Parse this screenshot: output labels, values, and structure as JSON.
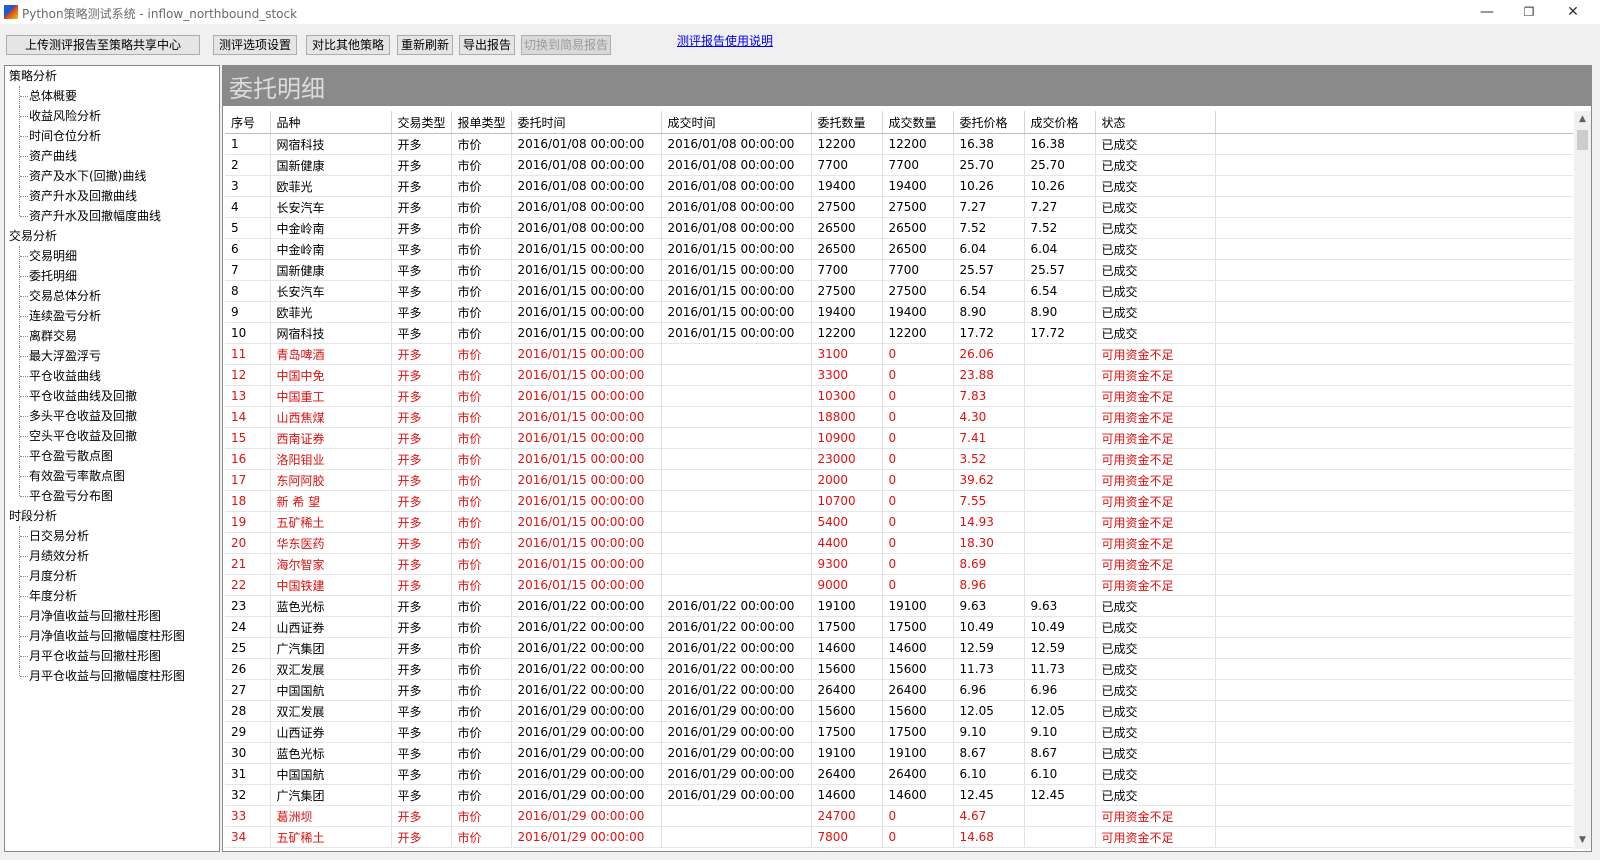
{
  "window": {
    "title": "Python策略测试系统 - inflow_northbound_stock",
    "minimize": "—",
    "maximize": "❐",
    "close": "✕"
  },
  "toolbar": {
    "upload_label": "上传测评报告至策略共享中心",
    "settings_label": "测评选项设置",
    "compare_label": "对比其他策略",
    "refresh_label": "重新刷新",
    "export_label": "导出报告",
    "simple_label": "切换到简易报告",
    "help_link": "测评报告使用说明"
  },
  "sidebar": {
    "sections": [
      {
        "label": "策略分析",
        "items": [
          "总体概要",
          "收益风险分析",
          "时间仓位分析",
          "资产曲线",
          "资产及水下(回撤)曲线",
          "资产升水及回撤曲线",
          "资产升水及回撤幅度曲线"
        ]
      },
      {
        "label": "交易分析",
        "items": [
          "交易明细",
          "委托明细",
          "交易总体分析",
          "连续盈亏分析",
          "离群交易",
          "最大浮盈浮亏",
          "平仓收益曲线",
          "平仓收益曲线及回撤",
          "多头平仓收益及回撤",
          "空头平仓收益及回撤",
          "平仓盈亏散点图",
          "有效盈亏率散点图",
          "平仓盈亏分布图"
        ]
      },
      {
        "label": "时段分析",
        "items": [
          "日交易分析",
          "月绩效分析",
          "月度分析",
          "年度分析",
          "月净值收益与回撤柱形图",
          "月净值收益与回撤幅度柱形图",
          "月平仓收益与回撤柱形图",
          "月平仓收益与回撤幅度柱形图"
        ]
      }
    ]
  },
  "main": {
    "section_title": "委托明细",
    "columns": [
      "序号",
      "品种",
      "交易类型",
      "报单类型",
      "委托时间",
      "成交时间",
      "委托数量",
      "成交数量",
      "委托价格",
      "成交价格",
      "状态"
    ],
    "rows": [
      [
        "1",
        "网宿科技",
        "开多",
        "市价",
        "2016/01/08 00:00:00",
        "2016/01/08 00:00:00",
        "12200",
        "12200",
        "16.38",
        "16.38",
        "已成交"
      ],
      [
        "2",
        "国新健康",
        "开多",
        "市价",
        "2016/01/08 00:00:00",
        "2016/01/08 00:00:00",
        "7700",
        "7700",
        "25.70",
        "25.70",
        "已成交"
      ],
      [
        "3",
        "欧菲光",
        "开多",
        "市价",
        "2016/01/08 00:00:00",
        "2016/01/08 00:00:00",
        "19400",
        "19400",
        "10.26",
        "10.26",
        "已成交"
      ],
      [
        "4",
        "长安汽车",
        "开多",
        "市价",
        "2016/01/08 00:00:00",
        "2016/01/08 00:00:00",
        "27500",
        "27500",
        "7.27",
        "7.27",
        "已成交"
      ],
      [
        "5",
        "中金岭南",
        "开多",
        "市价",
        "2016/01/08 00:00:00",
        "2016/01/08 00:00:00",
        "26500",
        "26500",
        "7.52",
        "7.52",
        "已成交"
      ],
      [
        "6",
        "中金岭南",
        "平多",
        "市价",
        "2016/01/15 00:00:00",
        "2016/01/15 00:00:00",
        "26500",
        "26500",
        "6.04",
        "6.04",
        "已成交"
      ],
      [
        "7",
        "国新健康",
        "平多",
        "市价",
        "2016/01/15 00:00:00",
        "2016/01/15 00:00:00",
        "7700",
        "7700",
        "25.57",
        "25.57",
        "已成交"
      ],
      [
        "8",
        "长安汽车",
        "平多",
        "市价",
        "2016/01/15 00:00:00",
        "2016/01/15 00:00:00",
        "27500",
        "27500",
        "6.54",
        "6.54",
        "已成交"
      ],
      [
        "9",
        "欧菲光",
        "平多",
        "市价",
        "2016/01/15 00:00:00",
        "2016/01/15 00:00:00",
        "19400",
        "19400",
        "8.90",
        "8.90",
        "已成交"
      ],
      [
        "10",
        "网宿科技",
        "平多",
        "市价",
        "2016/01/15 00:00:00",
        "2016/01/15 00:00:00",
        "12200",
        "12200",
        "17.72",
        "17.72",
        "已成交"
      ],
      [
        "11",
        "青岛啤酒",
        "开多",
        "市价",
        "2016/01/15 00:00:00",
        "",
        "3100",
        "0",
        "26.06",
        "",
        "可用资金不足"
      ],
      [
        "12",
        "中国中免",
        "开多",
        "市价",
        "2016/01/15 00:00:00",
        "",
        "3300",
        "0",
        "23.88",
        "",
        "可用资金不足"
      ],
      [
        "13",
        "中国重工",
        "开多",
        "市价",
        "2016/01/15 00:00:00",
        "",
        "10300",
        "0",
        "7.83",
        "",
        "可用资金不足"
      ],
      [
        "14",
        "山西焦煤",
        "开多",
        "市价",
        "2016/01/15 00:00:00",
        "",
        "18800",
        "0",
        "4.30",
        "",
        "可用资金不足"
      ],
      [
        "15",
        "西南证券",
        "开多",
        "市价",
        "2016/01/15 00:00:00",
        "",
        "10900",
        "0",
        "7.41",
        "",
        "可用资金不足"
      ],
      [
        "16",
        "洛阳钼业",
        "开多",
        "市价",
        "2016/01/15 00:00:00",
        "",
        "23000",
        "0",
        "3.52",
        "",
        "可用资金不足"
      ],
      [
        "17",
        "东阿阿胶",
        "开多",
        "市价",
        "2016/01/15 00:00:00",
        "",
        "2000",
        "0",
        "39.62",
        "",
        "可用资金不足"
      ],
      [
        "18",
        "新 希 望",
        "开多",
        "市价",
        "2016/01/15 00:00:00",
        "",
        "10700",
        "0",
        "7.55",
        "",
        "可用资金不足"
      ],
      [
        "19",
        "五矿稀土",
        "开多",
        "市价",
        "2016/01/15 00:00:00",
        "",
        "5400",
        "0",
        "14.93",
        "",
        "可用资金不足"
      ],
      [
        "20",
        "华东医药",
        "开多",
        "市价",
        "2016/01/15 00:00:00",
        "",
        "4400",
        "0",
        "18.30",
        "",
        "可用资金不足"
      ],
      [
        "21",
        "海尔智家",
        "开多",
        "市价",
        "2016/01/15 00:00:00",
        "",
        "9300",
        "0",
        "8.69",
        "",
        "可用资金不足"
      ],
      [
        "22",
        "中国铁建",
        "开多",
        "市价",
        "2016/01/15 00:00:00",
        "",
        "9000",
        "0",
        "8.96",
        "",
        "可用资金不足"
      ],
      [
        "23",
        "蓝色光标",
        "开多",
        "市价",
        "2016/01/22 00:00:00",
        "2016/01/22 00:00:00",
        "19100",
        "19100",
        "9.63",
        "9.63",
        "已成交"
      ],
      [
        "24",
        "山西证券",
        "开多",
        "市价",
        "2016/01/22 00:00:00",
        "2016/01/22 00:00:00",
        "17500",
        "17500",
        "10.49",
        "10.49",
        "已成交"
      ],
      [
        "25",
        "广汽集团",
        "开多",
        "市价",
        "2016/01/22 00:00:00",
        "2016/01/22 00:00:00",
        "14600",
        "14600",
        "12.59",
        "12.59",
        "已成交"
      ],
      [
        "26",
        "双汇发展",
        "开多",
        "市价",
        "2016/01/22 00:00:00",
        "2016/01/22 00:00:00",
        "15600",
        "15600",
        "11.73",
        "11.73",
        "已成交"
      ],
      [
        "27",
        "中国国航",
        "开多",
        "市价",
        "2016/01/22 00:00:00",
        "2016/01/22 00:00:00",
        "26400",
        "26400",
        "6.96",
        "6.96",
        "已成交"
      ],
      [
        "28",
        "双汇发展",
        "平多",
        "市价",
        "2016/01/29 00:00:00",
        "2016/01/29 00:00:00",
        "15600",
        "15600",
        "12.05",
        "12.05",
        "已成交"
      ],
      [
        "29",
        "山西证券",
        "平多",
        "市价",
        "2016/01/29 00:00:00",
        "2016/01/29 00:00:00",
        "17500",
        "17500",
        "9.10",
        "9.10",
        "已成交"
      ],
      [
        "30",
        "蓝色光标",
        "平多",
        "市价",
        "2016/01/29 00:00:00",
        "2016/01/29 00:00:00",
        "19100",
        "19100",
        "8.67",
        "8.67",
        "已成交"
      ],
      [
        "31",
        "中国国航",
        "平多",
        "市价",
        "2016/01/29 00:00:00",
        "2016/01/29 00:00:00",
        "26400",
        "26400",
        "6.10",
        "6.10",
        "已成交"
      ],
      [
        "32",
        "广汽集团",
        "平多",
        "市价",
        "2016/01/29 00:00:00",
        "2016/01/29 00:00:00",
        "14600",
        "14600",
        "12.45",
        "12.45",
        "已成交"
      ],
      [
        "33",
        "葛洲坝",
        "开多",
        "市价",
        "2016/01/29 00:00:00",
        "",
        "24700",
        "0",
        "4.67",
        "",
        "可用资金不足"
      ],
      [
        "34",
        "五矿稀土",
        "开多",
        "市价",
        "2016/01/29 00:00:00",
        "",
        "7800",
        "0",
        "14.68",
        "",
        "可用资金不足"
      ]
    ],
    "failed_status": "可用资金不足",
    "colors": {
      "failed_row": "#e01010",
      "normal_row": "#000000",
      "header_bar": "#8a8a8a"
    }
  },
  "scrollbar": {
    "up": "▲",
    "down": "▼"
  }
}
